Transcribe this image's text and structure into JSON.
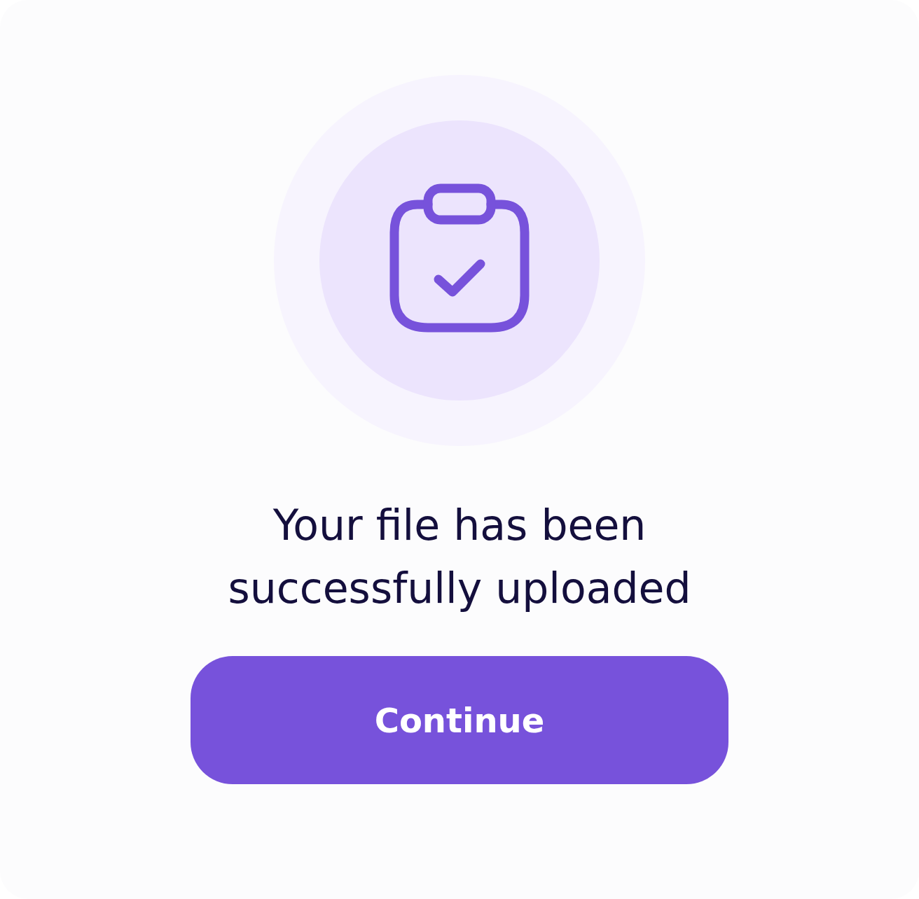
{
  "message": "Your file has been successfully uploaded",
  "button": {
    "label": "Continue"
  }
}
